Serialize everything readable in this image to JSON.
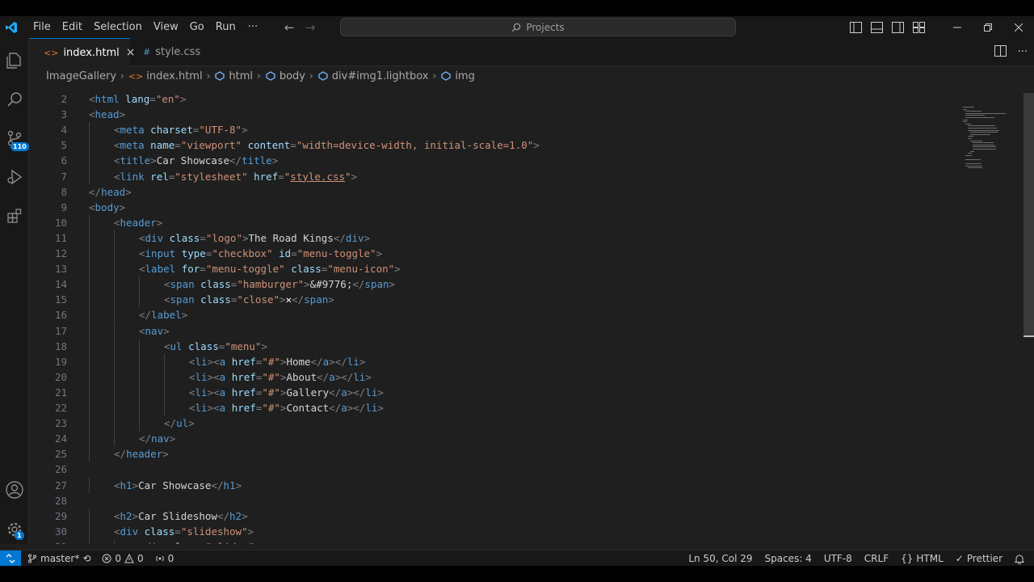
{
  "colors": {
    "accent": "#0078d4",
    "editor_bg": "#1f1f1f",
    "chrome_bg": "#181818"
  },
  "menu": [
    "File",
    "Edit",
    "Selection",
    "View",
    "Go",
    "Run"
  ],
  "menu_more": "···",
  "search": {
    "text": "Projects"
  },
  "tabs": [
    {
      "label": "index.html",
      "icon": "<>",
      "active": true
    },
    {
      "label": "style.css",
      "icon": "#",
      "active": false
    }
  ],
  "tab_close_symbol": "×",
  "breadcrumbs": {
    "folder": "ImageGallery",
    "file": "index.html",
    "html": "html",
    "body": "body",
    "div": "div#img1.lightbox",
    "img": "img"
  },
  "activity": {
    "scm_badge": "110",
    "settings_badge": "1"
  },
  "code_lines": [
    {
      "n": "2",
      "indent": 0,
      "tokens": [
        [
          "br",
          "<"
        ],
        [
          "tag",
          "html"
        ],
        [
          "txt",
          " "
        ],
        [
          "attr",
          "lang"
        ],
        [
          "br",
          "="
        ],
        [
          "str",
          "\"en\""
        ],
        [
          "br",
          ">"
        ]
      ]
    },
    {
      "n": "3",
      "indent": 0,
      "tokens": [
        [
          "br",
          "<"
        ],
        [
          "tag",
          "head"
        ],
        [
          "br",
          ">"
        ]
      ]
    },
    {
      "n": "4",
      "indent": 1,
      "tokens": [
        [
          "br",
          "<"
        ],
        [
          "tag",
          "meta"
        ],
        [
          "txt",
          " "
        ],
        [
          "attr",
          "charset"
        ],
        [
          "br",
          "="
        ],
        [
          "str",
          "\"UTF-8\""
        ],
        [
          "br",
          ">"
        ]
      ]
    },
    {
      "n": "5",
      "indent": 1,
      "tokens": [
        [
          "br",
          "<"
        ],
        [
          "tag",
          "meta"
        ],
        [
          "txt",
          " "
        ],
        [
          "attr",
          "name"
        ],
        [
          "br",
          "="
        ],
        [
          "str",
          "\"viewport\""
        ],
        [
          "txt",
          " "
        ],
        [
          "attr",
          "content"
        ],
        [
          "br",
          "="
        ],
        [
          "str",
          "\"width=device-width, initial-scale=1.0\""
        ],
        [
          "br",
          ">"
        ]
      ]
    },
    {
      "n": "6",
      "indent": 1,
      "tokens": [
        [
          "br",
          "<"
        ],
        [
          "tag",
          "title"
        ],
        [
          "br",
          ">"
        ],
        [
          "txt",
          "Car Showcase"
        ],
        [
          "br",
          "</"
        ],
        [
          "tag",
          "title"
        ],
        [
          "br",
          ">"
        ]
      ]
    },
    {
      "n": "7",
      "indent": 1,
      "tokens": [
        [
          "br",
          "<"
        ],
        [
          "tag",
          "link"
        ],
        [
          "txt",
          " "
        ],
        [
          "attr",
          "rel"
        ],
        [
          "br",
          "="
        ],
        [
          "str",
          "\"stylesheet\""
        ],
        [
          "txt",
          " "
        ],
        [
          "attr",
          "href"
        ],
        [
          "br",
          "="
        ],
        [
          "str",
          "\""
        ],
        [
          "str",
          "style.css"
        ],
        [
          "str",
          "\""
        ],
        [
          "br",
          ">"
        ]
      ]
    },
    {
      "n": "8",
      "indent": 0,
      "tokens": [
        [
          "br",
          "</"
        ],
        [
          "tag",
          "head"
        ],
        [
          "br",
          ">"
        ]
      ]
    },
    {
      "n": "9",
      "indent": 0,
      "tokens": [
        [
          "br",
          "<"
        ],
        [
          "tag",
          "body"
        ],
        [
          "br",
          ">"
        ]
      ]
    },
    {
      "n": "10",
      "indent": 1,
      "tokens": [
        [
          "br",
          "<"
        ],
        [
          "tag",
          "header"
        ],
        [
          "br",
          ">"
        ]
      ]
    },
    {
      "n": "11",
      "indent": 2,
      "tokens": [
        [
          "br",
          "<"
        ],
        [
          "tag",
          "div"
        ],
        [
          "txt",
          " "
        ],
        [
          "attr",
          "class"
        ],
        [
          "br",
          "="
        ],
        [
          "str",
          "\"logo\""
        ],
        [
          "br",
          ">"
        ],
        [
          "txt",
          "The Road Kings"
        ],
        [
          "br",
          "</"
        ],
        [
          "tag",
          "div"
        ],
        [
          "br",
          ">"
        ]
      ]
    },
    {
      "n": "12",
      "indent": 2,
      "tokens": [
        [
          "br",
          "<"
        ],
        [
          "tag",
          "input"
        ],
        [
          "txt",
          " "
        ],
        [
          "attr",
          "type"
        ],
        [
          "br",
          "="
        ],
        [
          "str",
          "\"checkbox\""
        ],
        [
          "txt",
          " "
        ],
        [
          "attr",
          "id"
        ],
        [
          "br",
          "="
        ],
        [
          "str",
          "\"menu-toggle\""
        ],
        [
          "br",
          ">"
        ]
      ]
    },
    {
      "n": "13",
      "indent": 2,
      "tokens": [
        [
          "br",
          "<"
        ],
        [
          "tag",
          "label"
        ],
        [
          "txt",
          " "
        ],
        [
          "attr",
          "for"
        ],
        [
          "br",
          "="
        ],
        [
          "str",
          "\"menu-toggle\""
        ],
        [
          "txt",
          " "
        ],
        [
          "attr",
          "class"
        ],
        [
          "br",
          "="
        ],
        [
          "str",
          "\"menu-icon\""
        ],
        [
          "br",
          ">"
        ]
      ]
    },
    {
      "n": "14",
      "indent": 3,
      "tokens": [
        [
          "br",
          "<"
        ],
        [
          "tag",
          "span"
        ],
        [
          "txt",
          " "
        ],
        [
          "attr",
          "class"
        ],
        [
          "br",
          "="
        ],
        [
          "str",
          "\"hamburger\""
        ],
        [
          "br",
          ">"
        ],
        [
          "txt",
          "&#9776;"
        ],
        [
          "br",
          "</"
        ],
        [
          "tag",
          "span"
        ],
        [
          "br",
          ">"
        ]
      ]
    },
    {
      "n": "15",
      "indent": 3,
      "tokens": [
        [
          "br",
          "<"
        ],
        [
          "tag",
          "span"
        ],
        [
          "txt",
          " "
        ],
        [
          "attr",
          "class"
        ],
        [
          "br",
          "="
        ],
        [
          "str",
          "\"close\""
        ],
        [
          "br",
          ">"
        ],
        [
          "txt",
          "✕"
        ],
        [
          "br",
          "</"
        ],
        [
          "tag",
          "span"
        ],
        [
          "br",
          ">"
        ]
      ]
    },
    {
      "n": "16",
      "indent": 2,
      "tokens": [
        [
          "br",
          "</"
        ],
        [
          "tag",
          "label"
        ],
        [
          "br",
          ">"
        ]
      ]
    },
    {
      "n": "17",
      "indent": 2,
      "tokens": [
        [
          "br",
          "<"
        ],
        [
          "tag",
          "nav"
        ],
        [
          "br",
          ">"
        ]
      ]
    },
    {
      "n": "18",
      "indent": 3,
      "tokens": [
        [
          "br",
          "<"
        ],
        [
          "tag",
          "ul"
        ],
        [
          "txt",
          " "
        ],
        [
          "attr",
          "class"
        ],
        [
          "br",
          "="
        ],
        [
          "str",
          "\"menu\""
        ],
        [
          "br",
          ">"
        ]
      ]
    },
    {
      "n": "19",
      "indent": 4,
      "tokens": [
        [
          "br",
          "<"
        ],
        [
          "tag",
          "li"
        ],
        [
          "br",
          "><"
        ],
        [
          "tag",
          "a"
        ],
        [
          "txt",
          " "
        ],
        [
          "attr",
          "href"
        ],
        [
          "br",
          "="
        ],
        [
          "str",
          "\"#\""
        ],
        [
          "br",
          ">"
        ],
        [
          "txt",
          "Home"
        ],
        [
          "br",
          "</"
        ],
        [
          "tag",
          "a"
        ],
        [
          "br",
          "></"
        ],
        [
          "tag",
          "li"
        ],
        [
          "br",
          ">"
        ]
      ]
    },
    {
      "n": "20",
      "indent": 4,
      "tokens": [
        [
          "br",
          "<"
        ],
        [
          "tag",
          "li"
        ],
        [
          "br",
          "><"
        ],
        [
          "tag",
          "a"
        ],
        [
          "txt",
          " "
        ],
        [
          "attr",
          "href"
        ],
        [
          "br",
          "="
        ],
        [
          "str",
          "\"#\""
        ],
        [
          "br",
          ">"
        ],
        [
          "txt",
          "About"
        ],
        [
          "br",
          "</"
        ],
        [
          "tag",
          "a"
        ],
        [
          "br",
          "></"
        ],
        [
          "tag",
          "li"
        ],
        [
          "br",
          ">"
        ]
      ]
    },
    {
      "n": "21",
      "indent": 4,
      "tokens": [
        [
          "br",
          "<"
        ],
        [
          "tag",
          "li"
        ],
        [
          "br",
          "><"
        ],
        [
          "tag",
          "a"
        ],
        [
          "txt",
          " "
        ],
        [
          "attr",
          "href"
        ],
        [
          "br",
          "="
        ],
        [
          "str",
          "\"#\""
        ],
        [
          "br",
          ">"
        ],
        [
          "txt",
          "Gallery"
        ],
        [
          "br",
          "</"
        ],
        [
          "tag",
          "a"
        ],
        [
          "br",
          "></"
        ],
        [
          "tag",
          "li"
        ],
        [
          "br",
          ">"
        ]
      ]
    },
    {
      "n": "22",
      "indent": 4,
      "tokens": [
        [
          "br",
          "<"
        ],
        [
          "tag",
          "li"
        ],
        [
          "br",
          "><"
        ],
        [
          "tag",
          "a"
        ],
        [
          "txt",
          " "
        ],
        [
          "attr",
          "href"
        ],
        [
          "br",
          "="
        ],
        [
          "str",
          "\"#\""
        ],
        [
          "br",
          ">"
        ],
        [
          "txt",
          "Contact"
        ],
        [
          "br",
          "</"
        ],
        [
          "tag",
          "a"
        ],
        [
          "br",
          "></"
        ],
        [
          "tag",
          "li"
        ],
        [
          "br",
          ">"
        ]
      ]
    },
    {
      "n": "23",
      "indent": 3,
      "tokens": [
        [
          "br",
          "</"
        ],
        [
          "tag",
          "ul"
        ],
        [
          "br",
          ">"
        ]
      ]
    },
    {
      "n": "24",
      "indent": 2,
      "tokens": [
        [
          "br",
          "</"
        ],
        [
          "tag",
          "nav"
        ],
        [
          "br",
          ">"
        ]
      ]
    },
    {
      "n": "25",
      "indent": 1,
      "tokens": [
        [
          "br",
          "</"
        ],
        [
          "tag",
          "header"
        ],
        [
          "br",
          ">"
        ]
      ]
    },
    {
      "n": "26",
      "indent": 0,
      "tokens": []
    },
    {
      "n": "27",
      "indent": 1,
      "tokens": [
        [
          "br",
          "<"
        ],
        [
          "tag",
          "h1"
        ],
        [
          "br",
          ">"
        ],
        [
          "txt",
          "Car Showcase"
        ],
        [
          "br",
          "</"
        ],
        [
          "tag",
          "h1"
        ],
        [
          "br",
          ">"
        ]
      ]
    },
    {
      "n": "28",
      "indent": 0,
      "tokens": []
    },
    {
      "n": "29",
      "indent": 1,
      "tokens": [
        [
          "br",
          "<"
        ],
        [
          "tag",
          "h2"
        ],
        [
          "br",
          ">"
        ],
        [
          "txt",
          "Car Slideshow"
        ],
        [
          "br",
          "</"
        ],
        [
          "tag",
          "h2"
        ],
        [
          "br",
          ">"
        ]
      ]
    },
    {
      "n": "30",
      "indent": 1,
      "tokens": [
        [
          "br",
          "<"
        ],
        [
          "tag",
          "div"
        ],
        [
          "txt",
          " "
        ],
        [
          "attr",
          "class"
        ],
        [
          "br",
          "="
        ],
        [
          "str",
          "\"slideshow\""
        ],
        [
          "br",
          ">"
        ]
      ]
    },
    {
      "n": "31",
      "indent": 2,
      "tokens": [
        [
          "br",
          "<"
        ],
        [
          "tag",
          "div"
        ],
        [
          "txt",
          " "
        ],
        [
          "attr",
          "class"
        ],
        [
          "br",
          "="
        ],
        [
          "str",
          "\"slides\""
        ],
        [
          "br",
          ">"
        ]
      ]
    }
  ],
  "status": {
    "branch": "master*",
    "errors": "0",
    "warnings": "0",
    "ports": "0",
    "position": "Ln 50, Col 29",
    "spaces": "Spaces: 4",
    "encoding": "UTF-8",
    "eol": "CRLF",
    "language": "HTML",
    "formatter": "Prettier"
  }
}
